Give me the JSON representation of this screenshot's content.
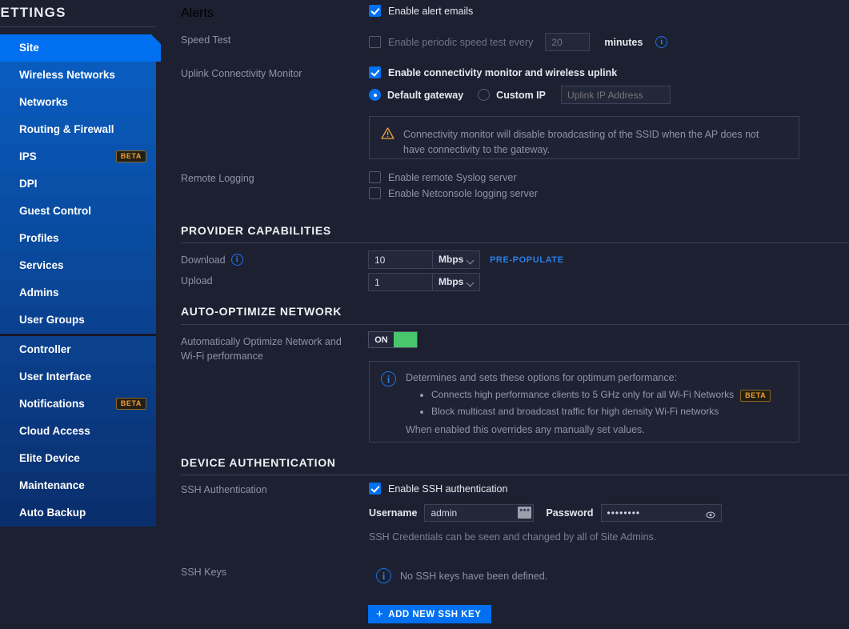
{
  "sidebar": {
    "title": "SETTINGS",
    "items": [
      {
        "label": "Site",
        "active": true,
        "badge": null
      },
      {
        "label": "Wireless Networks",
        "active": false,
        "badge": null
      },
      {
        "label": "Networks",
        "active": false,
        "badge": null
      },
      {
        "label": "Routing & Firewall",
        "active": false,
        "badge": null
      },
      {
        "label": "IPS",
        "active": false,
        "badge": "BETA"
      },
      {
        "label": "DPI",
        "active": false,
        "badge": null
      },
      {
        "label": "Guest Control",
        "active": false,
        "badge": null
      },
      {
        "label": "Profiles",
        "active": false,
        "badge": null
      },
      {
        "label": "Services",
        "active": false,
        "badge": null
      },
      {
        "label": "Admins",
        "active": false,
        "badge": null
      },
      {
        "label": "User Groups",
        "active": false,
        "badge": null
      },
      {
        "label": "Controller",
        "active": false,
        "badge": null
      },
      {
        "label": "User Interface",
        "active": false,
        "badge": null
      },
      {
        "label": "Notifications",
        "active": false,
        "badge": "BETA"
      },
      {
        "label": "Cloud Access",
        "active": false,
        "badge": null
      },
      {
        "label": "Elite Device",
        "active": false,
        "badge": null
      },
      {
        "label": "Maintenance",
        "active": false,
        "badge": null
      },
      {
        "label": "Auto Backup",
        "active": false,
        "badge": null
      }
    ]
  },
  "alerts": {
    "label": "Alerts",
    "enable_alert_emails": "Enable alert emails",
    "checked": true
  },
  "speed_test": {
    "label": "Speed Test",
    "enable_text": "Enable periodic speed test every",
    "checked": false,
    "interval_value": "",
    "interval_placeholder": "20",
    "unit": "minutes",
    "info_icon": "info-icon"
  },
  "uplink": {
    "label": "Uplink Connectivity Monitor",
    "enable_text": "Enable connectivity monitor and wireless uplink",
    "checked": true,
    "radio_default_gateway": "Default gateway",
    "radio_custom_ip": "Custom IP",
    "selected": "Default gateway",
    "ip_placeholder": "Uplink IP Address",
    "ip_value": "",
    "warning_icon": "warning-triangle-icon",
    "warning_text": "Connectivity monitor will disable broadcasting of the SSID when the AP does not have connectivity to the gateway."
  },
  "remote_logging": {
    "label": "Remote Logging",
    "syslog_text": "Enable remote Syslog server",
    "syslog_checked": false,
    "netconsole_text": "Enable Netconsole logging server",
    "netconsole_checked": false
  },
  "provider": {
    "heading": "PROVIDER CAPABILITIES",
    "download_label": "Download",
    "download_value": "10",
    "download_unit": "Mbps",
    "upload_label": "Upload",
    "upload_value": "1",
    "upload_unit": "Mbps",
    "prepopulate": "PRE-POPULATE",
    "info_icon": "info-icon"
  },
  "auto_optimize": {
    "heading": "AUTO-OPTIMIZE NETWORK",
    "label": "Automatically Optimize Network and Wi-Fi performance",
    "toggle_state": "ON",
    "info_icon": "info-icon",
    "info_intro": "Determines and sets these options for optimum performance:",
    "bullets": [
      {
        "text": "Connects high performance clients to 5 GHz only for all Wi-Fi Networks",
        "badge": "BETA"
      },
      {
        "text": "Block multicast and broadcast traffic for high density Wi-Fi networks",
        "badge": null
      }
    ],
    "info_outro": "When enabled this overrides any manually set values."
  },
  "device_auth": {
    "heading": "DEVICE AUTHENTICATION",
    "ssh_auth_label": "SSH Authentication",
    "enable_ssh_text": "Enable SSH authentication",
    "enable_ssh_checked": true,
    "username_label": "Username",
    "username_value": "admin",
    "password_label": "Password",
    "password_value": "••••••••",
    "password_eye_icon": "eye-icon",
    "note": "SSH Credentials can be seen and changed by all of Site Admins.",
    "ssh_keys_label": "SSH Keys",
    "no_keys_text": "No SSH keys have been defined.",
    "add_key_button": "ADD NEW SSH KEY",
    "info_icon": "info-icon",
    "plus_icon": "plus-icon"
  },
  "colors": {
    "accent_blue": "#0070f0",
    "background": "#1d2030",
    "beta_orange": "#f0a030",
    "toggle_green": "#49c66b",
    "link_blue": "#2b7fe8"
  }
}
